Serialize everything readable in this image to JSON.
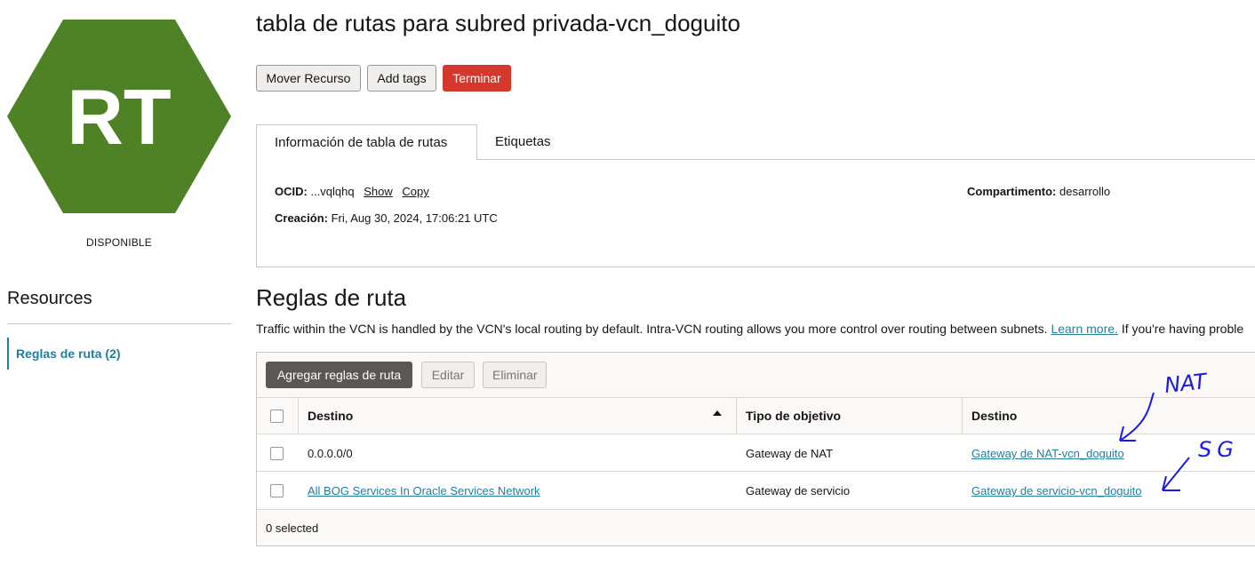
{
  "badge": {
    "initials": "RT",
    "status": "DISPONIBLE",
    "color": "#4f8227"
  },
  "resources": {
    "title": "Resources",
    "items": [
      {
        "label": "Reglas de ruta (2)"
      }
    ]
  },
  "header": {
    "title": "tabla de rutas para subred privada-vcn_doguito",
    "buttons": {
      "move": "Mover Recurso",
      "tags": "Add tags",
      "terminate": "Terminar"
    }
  },
  "tabs": [
    {
      "label": "Información de tabla de rutas"
    },
    {
      "label": "Etiquetas"
    }
  ],
  "info": {
    "ocid_label": "OCID:",
    "ocid_value": "...vqlqhq",
    "show": "Show",
    "copy": "Copy",
    "created_label": "Creación:",
    "created_value": "Fri, Aug 30, 2024, 17:06:21 UTC",
    "compartment_label": "Compartimento:",
    "compartment_value": "desarrollo"
  },
  "rules": {
    "title": "Reglas de ruta",
    "description": "Traffic within the VCN is handled by the VCN's local routing by default. Intra-VCN routing allows you more control over routing between subnets.",
    "learn_more": "Learn more.",
    "description_tail": "If you're having proble",
    "buttons": {
      "add": "Agregar reglas de ruta",
      "edit": "Editar",
      "delete": "Eliminar"
    },
    "columns": [
      "Destino",
      "Tipo de objetivo",
      "Destino"
    ],
    "rows": [
      {
        "destination": "0.0.0.0/0",
        "target_type": "Gateway de NAT",
        "target": "Gateway de NAT-vcn_doguito"
      },
      {
        "destination": "All BOG Services In Oracle Services Network",
        "target_type": "Gateway de servicio",
        "target": "Gateway de servicio-vcn_doguito"
      }
    ],
    "selected": "0 selected"
  },
  "annotations": {
    "label_1": "NAT",
    "label_2": "SG",
    "ink_color": "#1a1ae6"
  }
}
